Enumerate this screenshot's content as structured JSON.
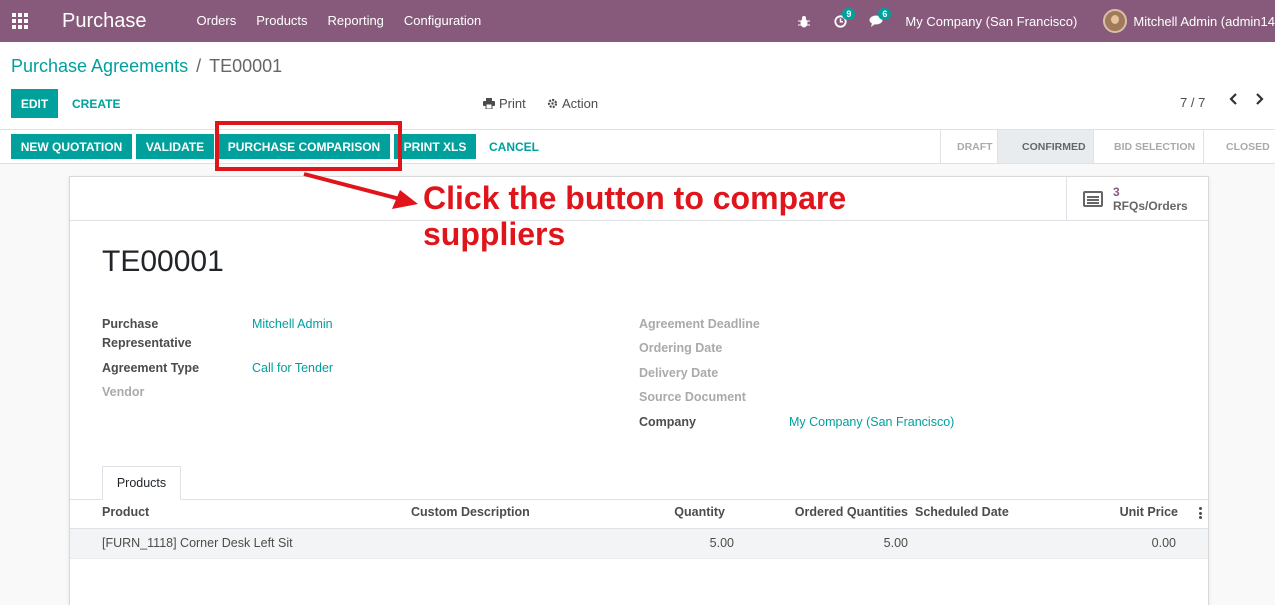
{
  "nav": {
    "brand": "Purchase",
    "menu": [
      "Orders",
      "Products",
      "Reporting",
      "Configuration"
    ],
    "activity_count": "9",
    "messages_count": "6",
    "company": "My Company (San Francisco)",
    "user": "Mitchell Admin (admin14"
  },
  "breadcrumb": {
    "parent": "Purchase Agreements",
    "current": "TE00001"
  },
  "toolbar": {
    "edit": "EDIT",
    "create": "CREATE",
    "print": "Print",
    "action": "Action",
    "pager": "7 / 7"
  },
  "statusbar": {
    "buttons": [
      "NEW QUOTATION",
      "VALIDATE",
      "PURCHASE COMPARISON",
      "PRINT XLS",
      "CANCEL"
    ],
    "stages": [
      "DRAFT",
      "CONFIRMED",
      "BID SELECTION",
      "CLOSED"
    ],
    "active_stage": "CONFIRMED"
  },
  "smart_button": {
    "count": "3",
    "label": "RFQs/Orders"
  },
  "record": {
    "name": "TE00001",
    "left_fields": [
      {
        "label": "Purchase Representative",
        "value": "Mitchell Admin"
      },
      {
        "label": "Agreement Type",
        "value": "Call for Tender"
      },
      {
        "label": "Vendor",
        "value": ""
      }
    ],
    "right_fields": [
      {
        "label": "Agreement Deadline",
        "value": ""
      },
      {
        "label": "Ordering Date",
        "value": ""
      },
      {
        "label": "Delivery Date",
        "value": ""
      },
      {
        "label": "Source Document",
        "value": ""
      },
      {
        "label": "Company",
        "value": "My Company (San Francisco)"
      }
    ]
  },
  "products_tab": {
    "tab_label": "Products",
    "columns": [
      "Product",
      "Custom Description",
      "Quantity",
      "Ordered Quantities",
      "Scheduled Date",
      "Unit Price"
    ],
    "rows": [
      {
        "product": "[FURN_1118] Corner Desk Left Sit",
        "description": "",
        "quantity": "5.00",
        "ordered": "5.00",
        "scheduled": "",
        "unit_price": "0.00"
      }
    ]
  },
  "annotation": {
    "text": "Click the button to compare suppliers",
    "color": "#e0151b"
  },
  "colors": {
    "brand": "#875a7b",
    "accent": "#00a09d"
  }
}
